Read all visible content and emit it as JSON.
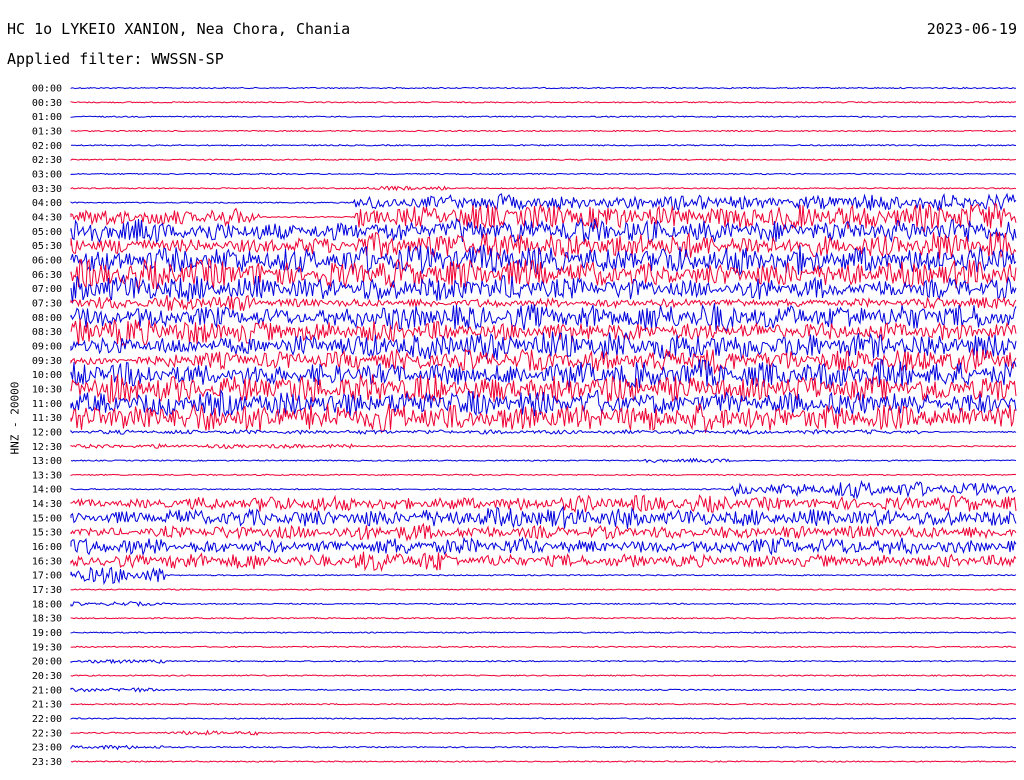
{
  "header": {
    "station": "HC 1o LYKEIO XANION, Nea Chora, Chania",
    "date": "2023-06-19",
    "filter": "Applied filter: WWSSN-SP",
    "channel_label": "HNZ - 20000"
  },
  "colors": {
    "even_trace": "#0000dd",
    "odd_trace": "#ee0033",
    "text": "#000000"
  },
  "chart_data": {
    "type": "line",
    "title": "HC 1o LYKEIO XANION, Nea Chora, Chania",
    "ylabel": "HNZ - 20000",
    "row_labels": [
      "00:00",
      "00:30",
      "01:00",
      "01:30",
      "02:00",
      "02:30",
      "03:00",
      "03:30",
      "04:00",
      "04:30",
      "05:00",
      "05:30",
      "06:00",
      "06:30",
      "07:00",
      "07:30",
      "08:00",
      "08:30",
      "09:00",
      "09:30",
      "10:00",
      "10:30",
      "11:00",
      "11:30",
      "12:00",
      "12:30",
      "13:00",
      "13:30",
      "14:00",
      "14:30",
      "15:00",
      "15:30",
      "16:00",
      "16:30",
      "17:00",
      "17:30",
      "18:00",
      "18:30",
      "19:00",
      "19:30",
      "20:00",
      "20:30",
      "21:00",
      "21:30",
      "22:00",
      "22:30",
      "23:00",
      "23:30"
    ],
    "trace_colors": [
      "blue",
      "red"
    ],
    "activity": [
      [
        0,
        0,
        0,
        0,
        0,
        0,
        0,
        0,
        0,
        0
      ],
      [
        0,
        0,
        0,
        0,
        0,
        0,
        0,
        0,
        0,
        0
      ],
      [
        0,
        0,
        0,
        0,
        0,
        0,
        0,
        0,
        0,
        0
      ],
      [
        0,
        0,
        0,
        0,
        0,
        0,
        0,
        0,
        0,
        0
      ],
      [
        0,
        0,
        0,
        0,
        0,
        0,
        0,
        0,
        0,
        0
      ],
      [
        0,
        0,
        0,
        0,
        0,
        0,
        0,
        0,
        0,
        0
      ],
      [
        0,
        0,
        0,
        0,
        0,
        0,
        0,
        0,
        0,
        0
      ],
      [
        0,
        0,
        0,
        1,
        0,
        0,
        0,
        0,
        0,
        0
      ],
      [
        0,
        0,
        0,
        3,
        4,
        3,
        4,
        3,
        4,
        4
      ],
      [
        4,
        4,
        0,
        5,
        6,
        6,
        5,
        6,
        6,
        7
      ],
      [
        6,
        5,
        4,
        5,
        6,
        6,
        5,
        5,
        5,
        6
      ],
      [
        4,
        3,
        4,
        6,
        7,
        6,
        6,
        5,
        5,
        7
      ],
      [
        6,
        6,
        6,
        7,
        7,
        6,
        7,
        7,
        6,
        6
      ],
      [
        7,
        7,
        6,
        7,
        7,
        6,
        5,
        6,
        6,
        7
      ],
      [
        7,
        6,
        5,
        6,
        6,
        5,
        4,
        5,
        4,
        5
      ],
      [
        3,
        4,
        2,
        2,
        2,
        2,
        2,
        2,
        2,
        3
      ],
      [
        5,
        5,
        4,
        6,
        6,
        6,
        7,
        6,
        6,
        6
      ],
      [
        7,
        6,
        5,
        5,
        4,
        5,
        4,
        4,
        4,
        4
      ],
      [
        4,
        4,
        5,
        6,
        7,
        7,
        7,
        6,
        6,
        6
      ],
      [
        2,
        4,
        4,
        5,
        5,
        5,
        6,
        5,
        5,
        6
      ],
      [
        6,
        5,
        5,
        5,
        5,
        6,
        7,
        6,
        7,
        6
      ],
      [
        7,
        6,
        7,
        7,
        6,
        7,
        6,
        6,
        6,
        6
      ],
      [
        5,
        6,
        6,
        6,
        6,
        6,
        5,
        5,
        6,
        5
      ],
      [
        7,
        7,
        7,
        7,
        6,
        6,
        7,
        6,
        6,
        6
      ],
      [
        1,
        1,
        1,
        1,
        1,
        1,
        1,
        1,
        1,
        0
      ],
      [
        1,
        1,
        1,
        0,
        0,
        0,
        0,
        0,
        0,
        0
      ],
      [
        0,
        0,
        0,
        0,
        0,
        0,
        1,
        0,
        0,
        0
      ],
      [
        0,
        0,
        0,
        0,
        0,
        0,
        0,
        0,
        0,
        0
      ],
      [
        0,
        0,
        0,
        0,
        0,
        0,
        0,
        3,
        4,
        3
      ],
      [
        2,
        3,
        4,
        3,
        3,
        4,
        4,
        3,
        3,
        4
      ],
      [
        3,
        4,
        4,
        4,
        5,
        5,
        4,
        4,
        4,
        4
      ],
      [
        2,
        3,
        3,
        4,
        3,
        3,
        3,
        3,
        3,
        3
      ],
      [
        4,
        3,
        3,
        4,
        4,
        3,
        3,
        4,
        4,
        3
      ],
      [
        3,
        4,
        3,
        5,
        3,
        3,
        3,
        3,
        3,
        3
      ],
      [
        4,
        0,
        0,
        0,
        0,
        0,
        0,
        0,
        0,
        0
      ],
      [
        0,
        0,
        0,
        0,
        0,
        0,
        0,
        0,
        0,
        0
      ],
      [
        1,
        0,
        0,
        0,
        0,
        0,
        0,
        0,
        0,
        0
      ],
      [
        0,
        0,
        0,
        0,
        0,
        0,
        0,
        0,
        0,
        0
      ],
      [
        0,
        0,
        0,
        0,
        0,
        0,
        0,
        0,
        0,
        0
      ],
      [
        0,
        0,
        0,
        0,
        0,
        0,
        0,
        0,
        0,
        0
      ],
      [
        1,
        0,
        0,
        0,
        0,
        0,
        0,
        0,
        0,
        0
      ],
      [
        0,
        0,
        0,
        0,
        0,
        0,
        0,
        0,
        0,
        0
      ],
      [
        1,
        0,
        0,
        0,
        0,
        0,
        0,
        0,
        0,
        0
      ],
      [
        0,
        0,
        0,
        0,
        0,
        0,
        0,
        0,
        0,
        0
      ],
      [
        0,
        0,
        0,
        0,
        0,
        0,
        0,
        0,
        0,
        0
      ],
      [
        0,
        1,
        0,
        0,
        0,
        0,
        0,
        0,
        0,
        0
      ],
      [
        1,
        0,
        0,
        0,
        0,
        0,
        0,
        0,
        0,
        0
      ],
      [
        0,
        0,
        0,
        0,
        0,
        0,
        0,
        0,
        0,
        0
      ]
    ]
  }
}
